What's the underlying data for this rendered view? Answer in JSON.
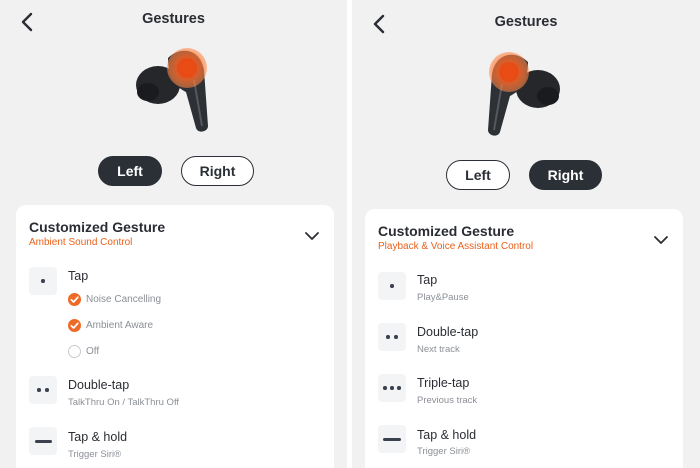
{
  "left_screen": {
    "title": "Gestures",
    "side_left_label": "Left",
    "side_right_label": "Right",
    "selected_side": "Left",
    "card": {
      "title": "Customized Gesture",
      "subtitle": "Ambient Sound Control",
      "gestures": [
        {
          "name": "Tap",
          "icon": "single-dot-icon",
          "options": [
            {
              "label": "Noise Cancelling",
              "checked": true
            },
            {
              "label": "Ambient Aware",
              "checked": true
            },
            {
              "label": "Off",
              "checked": false
            }
          ]
        },
        {
          "name": "Double-tap",
          "icon": "double-dot-icon",
          "desc": "TalkThru On / TalkThru Off"
        },
        {
          "name": "Tap & hold",
          "icon": "hold-bar-icon",
          "desc": "Trigger Siri®"
        }
      ]
    }
  },
  "right_screen": {
    "title": "Gestures",
    "side_left_label": "Left",
    "side_right_label": "Right",
    "selected_side": "Right",
    "card": {
      "title": "Customized Gesture",
      "subtitle": "Playback & Voice Assistant Control",
      "gestures": [
        {
          "name": "Tap",
          "icon": "single-dot-icon",
          "desc": "Play&Pause"
        },
        {
          "name": "Double-tap",
          "icon": "double-dot-icon",
          "desc": "Next track"
        },
        {
          "name": "Triple-tap",
          "icon": "triple-dot-icon",
          "desc": "Previous track"
        },
        {
          "name": "Tap & hold",
          "icon": "hold-bar-icon",
          "desc": "Trigger Siri®"
        }
      ]
    }
  },
  "colors": {
    "accent": "#ef6a27",
    "subtitle": "#e8611c",
    "button_dark": "#2b2f36",
    "background": "#f1f1f1",
    "card": "#ffffff"
  }
}
